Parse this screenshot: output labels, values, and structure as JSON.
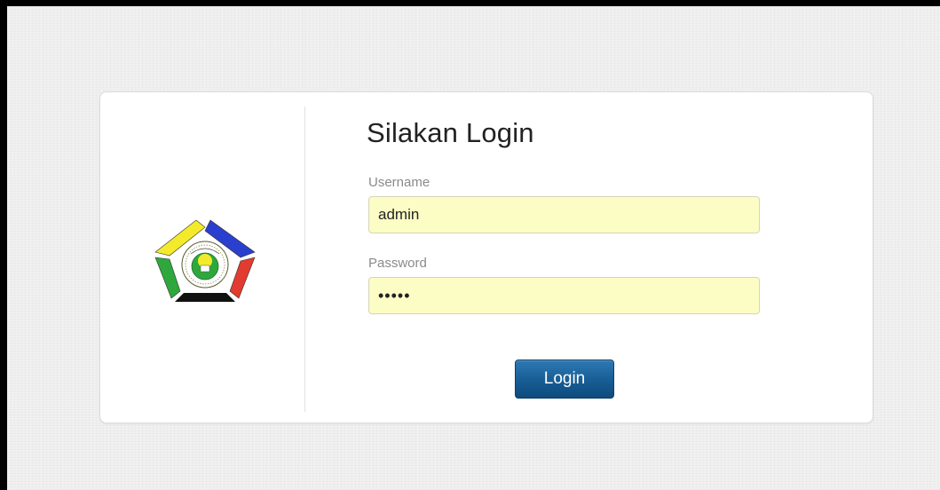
{
  "login": {
    "title": "Silakan Login",
    "username_label": "Username",
    "username_value": "admin",
    "password_label": "Password",
    "password_value": "•••••",
    "button_label": "Login"
  },
  "logo": {
    "icon": "pentagon-emblem-logo",
    "colors": {
      "yellow": "#f3ea2b",
      "blue": "#2b3fce",
      "red": "#e23b2f",
      "green": "#2ea83c",
      "black": "#111111"
    }
  },
  "theme": {
    "button_color": "#165a91",
    "input_bg": "#fcfcc5"
  }
}
